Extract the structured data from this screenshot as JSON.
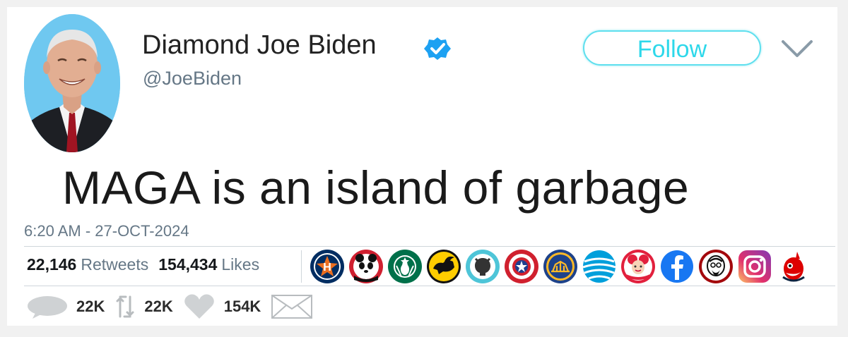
{
  "tweet": {
    "author": {
      "display_name": "Diamond Joe Biden",
      "handle": "@JoeBiden",
      "verified_icon": "verified-badge-icon",
      "avatar_bg": "#6fc8f0"
    },
    "follow_label": "Follow",
    "menu_icon": "chevron-down-icon",
    "text": "MAGA is an island of garbage",
    "timestamp": "6:20 AM - 27-OCT-2024",
    "stats": {
      "retweets_count": "22,146",
      "retweets_label": "Retweets",
      "likes_count": "154,434",
      "likes_label": "Likes"
    },
    "liker_logos": [
      "astros-logo",
      "panda-express-logo",
      "starbucks-logo",
      "buffalo-wild-wings-logo",
      "github-logo",
      "captain-america-shield-logo",
      "golden-state-warriors-logo",
      "att-logo",
      "wendys-logo",
      "facebook-logo",
      "kfc-logo",
      "instagram-logo",
      "cleveland-indians-logo"
    ],
    "actions": {
      "reply_count": "22K",
      "retweet_count": "22K",
      "like_count": "154K"
    },
    "colors": {
      "accent": "#2ed8ea",
      "muted_text": "#657786",
      "verified": "#1da1f2"
    }
  }
}
